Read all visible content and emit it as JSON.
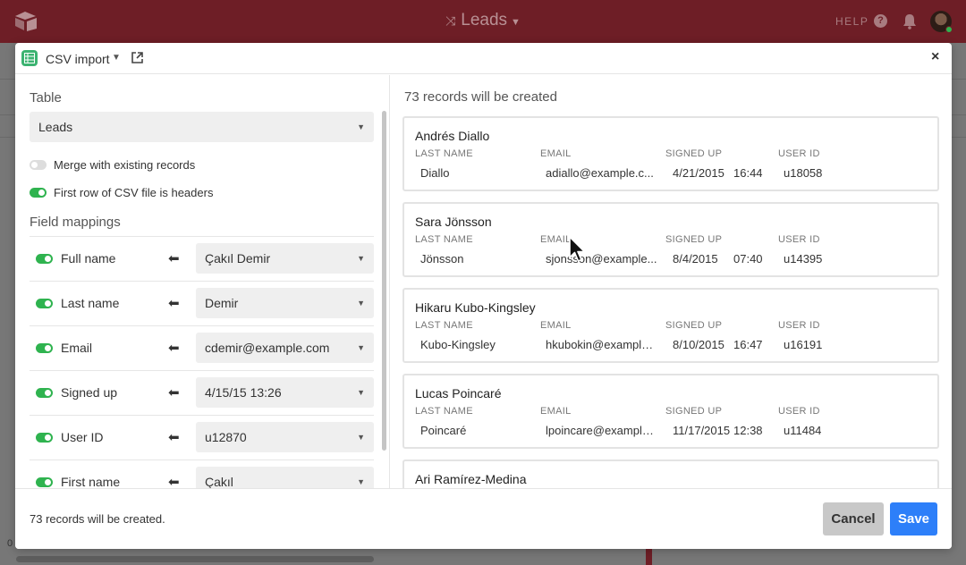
{
  "app": {
    "base_name": "Leads",
    "help_label": "HELP"
  },
  "colors": {
    "topbar": "#6e1e26",
    "toggle_on": "#2fb34f",
    "save_button": "#2d7ff9",
    "block_icon": "#3cb371"
  },
  "modal": {
    "block_name": "CSV import",
    "left": {
      "table_title": "Table",
      "table_select": "Leads",
      "merge_label": "Merge with existing records",
      "merge_on": false,
      "headers_label": "First row of CSV file is headers",
      "headers_on": true,
      "field_mappings_title": "Field mappings",
      "mappings": [
        {
          "field": "Full name",
          "value": "Çakıl Demir"
        },
        {
          "field": "Last name",
          "value": "Demir"
        },
        {
          "field": "Email",
          "value": "cdemir@example.com"
        },
        {
          "field": "Signed up",
          "value": "4/15/15 13:26"
        },
        {
          "field": "User ID",
          "value": "u12870"
        },
        {
          "field": "First name",
          "value": "Çakıl"
        }
      ]
    },
    "right": {
      "records_title": "73 records will be created",
      "columns": [
        "LAST NAME",
        "EMAIL",
        "SIGNED UP",
        "USER ID"
      ],
      "records": [
        {
          "name": "Andrés Diallo",
          "last_name": "Diallo",
          "email": "adiallo@example.c...",
          "date": "4/21/2015",
          "time": "16:44",
          "user_id": "u18058"
        },
        {
          "name": "Sara Jönsson",
          "last_name": "Jönsson",
          "email": "sjonsson@example...",
          "date": "8/4/2015",
          "time": "07:40",
          "user_id": "u14395"
        },
        {
          "name": "Hikaru Kubo-Kingsley",
          "last_name": "Kubo-Kingsley",
          "email": "hkubokin@example...",
          "date": "8/10/2015",
          "time": "16:47",
          "user_id": "u16191"
        },
        {
          "name": "Lucas Poincaré",
          "last_name": "Poincaré",
          "email": "lpoincare@example...",
          "date": "11/17/2015",
          "time": "12:38",
          "user_id": "u11484"
        },
        {
          "name": "Ari Ramírez-Medina"
        }
      ]
    },
    "footer": {
      "status": "73 records will be created.",
      "cancel_label": "Cancel",
      "save_label": "Save"
    }
  },
  "background": {
    "row_number": "0"
  }
}
